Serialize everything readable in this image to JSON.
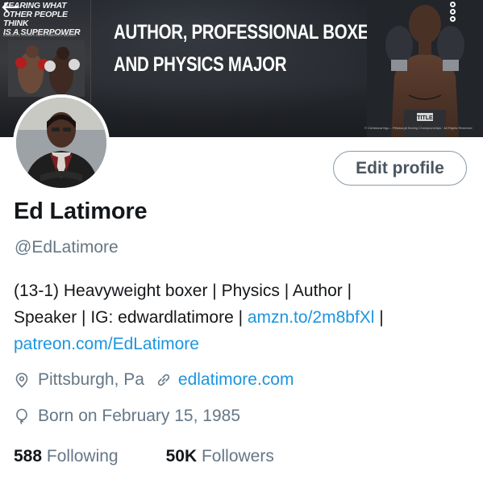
{
  "banner": {
    "book_title_lines": [
      "FEARING WHAT",
      "OTHER PEOPLE THINK",
      "IS A SUPERPOWER"
    ],
    "book_subtitle": "INSIGHTS FROM A HEAVYWEIGHT BOXER",
    "headline_lines": [
      "AUTHOR, PROFESSIONAL BOXER,",
      "AND PHYSICS MAJOR"
    ],
    "trunks_text": "TITLE",
    "photo_credit": "© Christiana Ngu... Pittsburgh Boxing Championships · All Rights Reserved"
  },
  "actions": {
    "edit_profile_label": "Edit profile"
  },
  "profile": {
    "name": "Ed Latimore",
    "handle": "@EdLatimore",
    "bio_text_1": "(13-1) Heavyweight boxer | Physics | Author |",
    "bio_text_2": "Speaker | IG: edwardlatimore | ",
    "bio_link_1": "amzn.to/2m8bfXl",
    "bio_text_3": " |",
    "bio_link_2": "patreon.com/EdLatimore",
    "location": "Pittsburgh, Pa",
    "website": "edlatimore.com",
    "birthday": "Born on February 15, 1985"
  },
  "stats": {
    "following_count": "588",
    "following_label": "Following",
    "followers_count": "50K",
    "followers_label": "Followers"
  },
  "colors": {
    "link": "#1b95e0",
    "secondary_text": "#657786",
    "primary_text": "#14171a",
    "banner_bg": "#1c1f24"
  },
  "icons": [
    "back-arrow-icon",
    "more-vertical-icon",
    "location-pin-icon",
    "link-icon",
    "birthday-balloon-icon"
  ]
}
